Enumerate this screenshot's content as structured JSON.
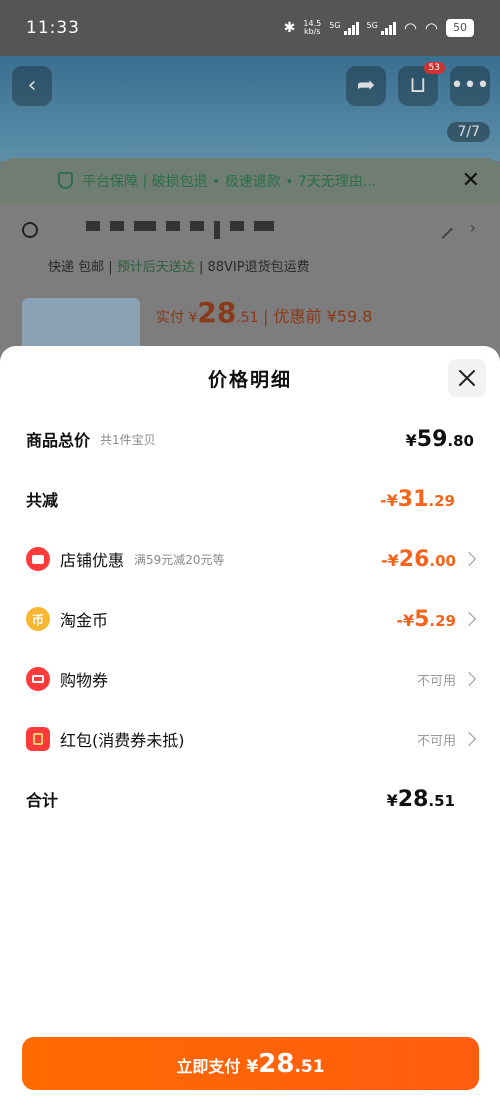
{
  "status_bar": {
    "time": "11:33",
    "net_speed": "14.5",
    "net_speed_unit": "kb/s",
    "signal_1": "5G",
    "signal_2": "5G",
    "battery": "50"
  },
  "background": {
    "cart_badge": "53",
    "image_counter": "7/7",
    "guarantee_text": "平台保障 | 破损包退 • 极速退款 • 7天无理由...",
    "shipping_express": "快递 包邮",
    "shipping_eta": "预计后天送达",
    "shipping_vip": "88VIP退货包运费",
    "price_prefix": "实付 ¥",
    "price_int": "28",
    "price_dec": ".51",
    "price_before": "| 优惠前 ¥59.8"
  },
  "modal": {
    "title": "价格明细",
    "rows": {
      "total": {
        "label": "商品总价",
        "sub": "共1件宝贝",
        "yen": "¥",
        "int": "59",
        "dec": ".80"
      },
      "discount": {
        "label": "共减",
        "yen": "-¥",
        "int": "31",
        "dec": ".29"
      },
      "store": {
        "label": "店铺优惠",
        "sub": "满59元减20元等",
        "yen": "-¥",
        "int": "26",
        "dec": ".00",
        "icon": "store-icon"
      },
      "coin": {
        "label": "淘金币",
        "yen": "-¥",
        "int": "5",
        "dec": ".29",
        "icon": "coin-icon",
        "icon_glyph": "币"
      },
      "voucher": {
        "label": "购物券",
        "status": "不可用",
        "icon": "coupon-icon"
      },
      "redpack": {
        "label": "红包(消费券未抵)",
        "status": "不可用",
        "icon": "red-packet-icon"
      },
      "sum": {
        "label": "合计",
        "yen": "¥",
        "int": "28",
        "dec": ".51"
      }
    }
  },
  "pay_button": {
    "label": "立即支付",
    "yen": "¥",
    "int": "28",
    "dec": ".51"
  },
  "colors": {
    "accent": "#f5641a",
    "pay_button": "#ff6a00",
    "close_bg": "#f2f2f4"
  }
}
